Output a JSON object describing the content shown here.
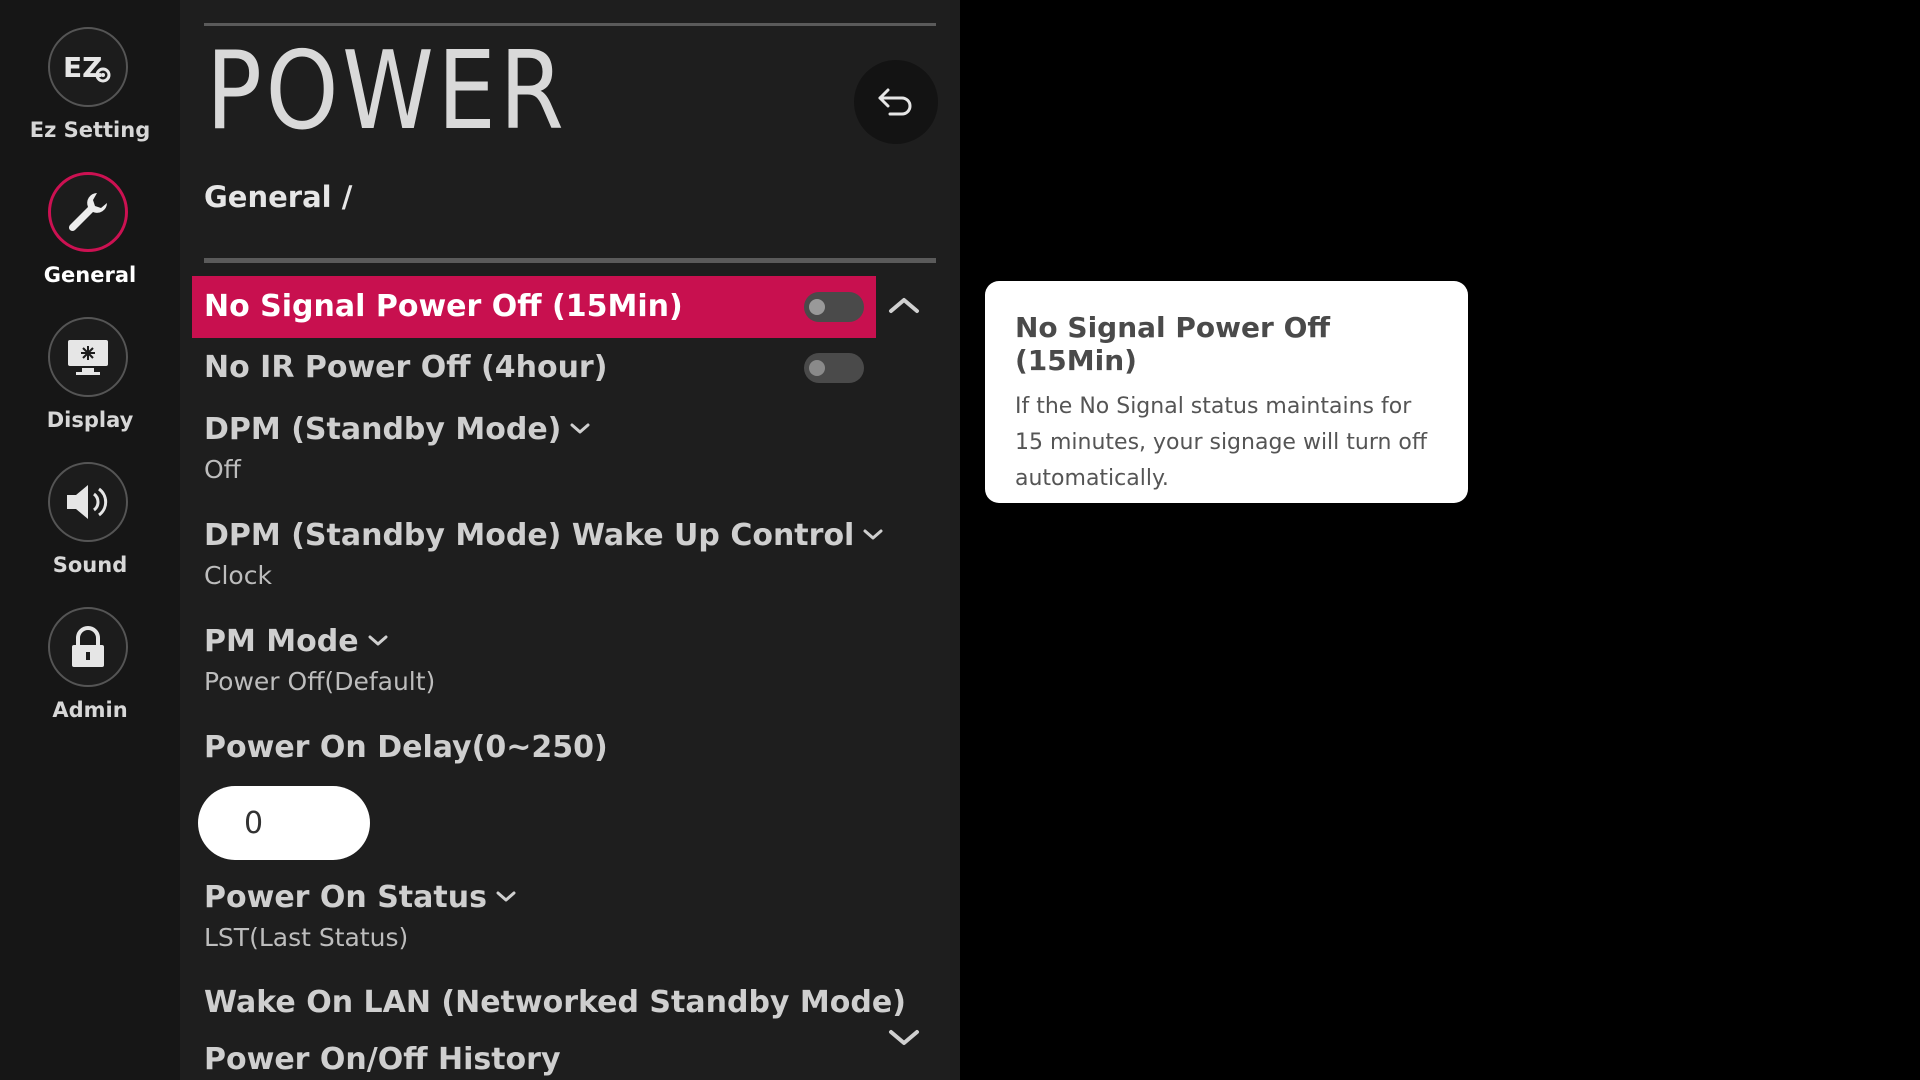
{
  "sidebar": {
    "items": [
      {
        "label": "Ez Setting",
        "icon": "ez-setting-icon",
        "active": false
      },
      {
        "label": "General",
        "icon": "wrench-icon",
        "active": true
      },
      {
        "label": "Display",
        "icon": "display-icon",
        "active": false
      },
      {
        "label": "Sound",
        "icon": "speaker-icon",
        "active": false
      },
      {
        "label": "Admin",
        "icon": "lock-icon",
        "active": false
      }
    ]
  },
  "header": {
    "title": "POWER",
    "breadcrumb": "General /",
    "back_icon": "back-arrow-icon"
  },
  "settings": {
    "no_signal": {
      "label": "No Signal Power Off (15Min)",
      "toggle": "off"
    },
    "no_ir": {
      "label": "No IR Power Off (4hour)",
      "toggle": "off"
    },
    "dpm": {
      "label": "DPM (Standby Mode)",
      "value": "Off"
    },
    "dpm_wake": {
      "label": "DPM (Standby Mode) Wake Up Control",
      "value": "Clock"
    },
    "pm_mode": {
      "label": "PM Mode",
      "value": "Power Off(Default)"
    },
    "power_on_delay": {
      "label": "Power On Delay(0~250)",
      "value": "0"
    },
    "power_on_status": {
      "label": "Power On Status",
      "value": "LST(Last Status)"
    },
    "wake_on_lan": {
      "label": "Wake On LAN (Networked Standby Mode)"
    },
    "history": {
      "label": "Power On/Off History"
    }
  },
  "info": {
    "title": "No Signal Power Off (15Min)",
    "body": "If the No Signal status maintains for 15 minutes, your signage will turn off automatically."
  },
  "colors": {
    "accent": "#c8104f",
    "panel": "#1e1e1e",
    "sidebar": "#161616"
  }
}
